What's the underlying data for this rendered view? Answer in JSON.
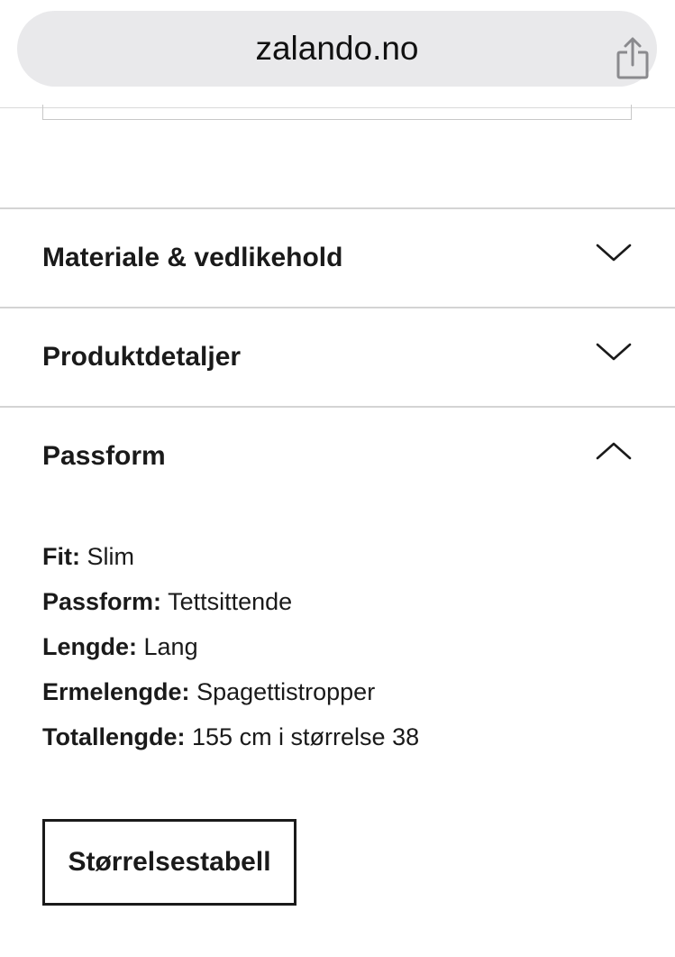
{
  "browser": {
    "url": "zalando.no"
  },
  "accordion": {
    "items": [
      {
        "title": "Materiale & vedlikehold",
        "expanded": false
      },
      {
        "title": "Produktdetaljer",
        "expanded": false
      },
      {
        "title": "Passform",
        "expanded": true
      }
    ]
  },
  "fit_details": [
    {
      "label": "Fit:",
      "value": "Slim"
    },
    {
      "label": "Passform:",
      "value": "Tettsittende"
    },
    {
      "label": "Lengde:",
      "value": "Lang"
    },
    {
      "label": "Ermelengde:",
      "value": "Spagettistropper"
    },
    {
      "label": "Totallengde:",
      "value": "155 cm i størrelse 38"
    }
  ],
  "size_table_button": "Størrelsestabell",
  "icons": {
    "share": "share-icon",
    "collapsed": "chevron-down-icon",
    "expanded": "chevron-up-icon"
  }
}
